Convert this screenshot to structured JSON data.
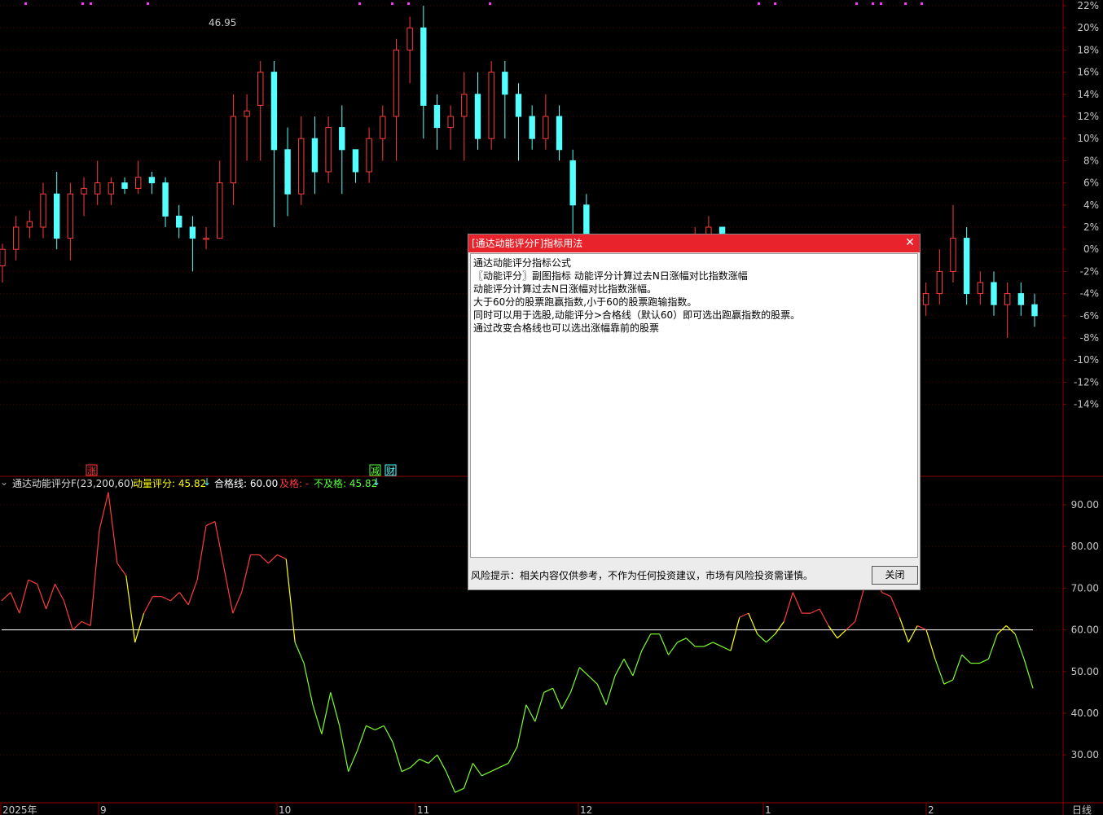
{
  "colors": {
    "up": "#ff3b3b",
    "down": "#54ffff",
    "ma_yellow": "#ffff00",
    "pass_line": "#ffffff",
    "grid": "#5a0000",
    "dialog_title": "#e8232b"
  },
  "price_axis": {
    "labels": [
      "22%",
      "20%",
      "18%",
      "16%",
      "14%",
      "12%",
      "10%",
      "8%",
      "6%",
      "4%",
      "2%",
      "0%",
      "-2%",
      "-4%",
      "-6%",
      "-8%",
      "-10%",
      "-12%",
      "-14%"
    ]
  },
  "indicator_axis": {
    "labels": [
      "90.00",
      "80.00",
      "70.00",
      "60.00",
      "50.00",
      "40.00",
      "30.00"
    ]
  },
  "time_axis": {
    "labels": [
      "2025年",
      "9",
      "10",
      "11",
      "12",
      "1",
      "2"
    ],
    "period": "日线"
  },
  "high_marker": "46.95",
  "event_badges": [
    "涨",
    "减",
    "财"
  ],
  "indicator": {
    "name": "通达动能评分F(23,200,60)",
    "score_label": "动量评分: 45.82",
    "pass_line_label": "合格线: 60.00",
    "pass_label": "及格: -",
    "fail_label": "不及格: 45.82"
  },
  "dialog": {
    "title": "[通达动能评分F]指标用法",
    "lines": [
      "通达动能评分指标公式",
      "",
      "〖动能评分〗副图指标 动能评分计算过去N日涨幅对比指数涨幅",
      "动能评分计算过去N日涨幅对比指数涨幅。",
      "大于60分的股票跑赢指数,小于60的股票跑输指数。",
      "",
      "同时可以用于选股,动能评分>合格线（默认60）即可选出跑赢指数的股票。",
      "通过改变合格线也可以选出涨幅靠前的股票"
    ],
    "risk_notice": "风险提示：相关内容仅供参考，不作为任何投资建议，市场有风险投资需谨慎。",
    "close_button": "关闭"
  },
  "chart_data": [
    {
      "type": "candlestick",
      "ylabel": "",
      "ylim": [
        -15,
        22
      ],
      "candles_pct": [
        [
          -1.5,
          0,
          -3,
          0.5
        ],
        [
          0,
          2,
          -1,
          3
        ],
        [
          2,
          2.5,
          1,
          3.5
        ],
        [
          2,
          5,
          1,
          6
        ],
        [
          5,
          1,
          0,
          7
        ],
        [
          1,
          5,
          -1,
          6
        ],
        [
          5,
          5.5,
          3,
          6.5
        ],
        [
          5,
          6,
          4,
          8
        ],
        [
          5,
          6,
          4,
          6.5
        ],
        [
          6,
          5.5,
          5,
          6.5
        ],
        [
          5.5,
          6.5,
          5,
          8
        ],
        [
          6.5,
          6,
          5,
          7
        ],
        [
          6,
          3,
          2,
          6.5
        ],
        [
          3,
          2,
          1,
          4
        ],
        [
          2,
          1,
          -2,
          3
        ],
        [
          1,
          1,
          0,
          2
        ],
        [
          1,
          6,
          1,
          8
        ],
        [
          6,
          12,
          4,
          14
        ],
        [
          12,
          12.5,
          8,
          14
        ],
        [
          13,
          16,
          8,
          17
        ],
        [
          16,
          9,
          2,
          17
        ],
        [
          9,
          5,
          3,
          11
        ],
        [
          5,
          10,
          4,
          12
        ],
        [
          10,
          7,
          5,
          12
        ],
        [
          7,
          11,
          6,
          12
        ],
        [
          11,
          9,
          5,
          13
        ],
        [
          9,
          7,
          6,
          9
        ],
        [
          7,
          10,
          6,
          11
        ],
        [
          10,
          12,
          8,
          13
        ],
        [
          12,
          18,
          8,
          19
        ],
        [
          18,
          20,
          15,
          21
        ],
        [
          20,
          13,
          10,
          22
        ],
        [
          13,
          11,
          9,
          14
        ],
        [
          11,
          12,
          9,
          13
        ],
        [
          12,
          14,
          8,
          16
        ],
        [
          14,
          10,
          9,
          16
        ],
        [
          10,
          16,
          9,
          17
        ],
        [
          16,
          14,
          10,
          17
        ],
        [
          14,
          12,
          8,
          15
        ],
        [
          12,
          10,
          9,
          13
        ],
        [
          10,
          12,
          9,
          14
        ],
        [
          12,
          9,
          8,
          13
        ],
        [
          8,
          4,
          0,
          9
        ],
        [
          4,
          -3,
          -5,
          5
        ],
        [
          -3,
          -1,
          -5,
          1
        ],
        [
          -1,
          -5,
          -6,
          0
        ],
        [
          -5,
          -7,
          -8,
          -4
        ],
        [
          -7,
          -5,
          -8,
          -4
        ],
        [
          -5,
          -3,
          -6,
          -2
        ],
        [
          -3,
          -4,
          -5,
          -2
        ],
        [
          -4,
          -1,
          -3,
          -2
        ],
        [
          -1,
          0,
          -3,
          2
        ],
        [
          0,
          2,
          -1,
          3
        ],
        [
          2,
          1,
          -1,
          2
        ],
        [
          1,
          -2,
          -3,
          0
        ],
        [
          -2,
          -3,
          -4,
          0
        ],
        [
          -3,
          -5,
          -6,
          -2
        ],
        [
          -5,
          -4,
          -5,
          -1
        ],
        [
          -4,
          -5,
          -6,
          -2
        ],
        [
          -5,
          -4,
          -6,
          -3
        ],
        [
          -4,
          -6,
          -7,
          -3
        ],
        [
          -6,
          -4,
          -7,
          -2
        ],
        [
          -4,
          -5,
          -6,
          -3
        ],
        [
          -5,
          -6,
          -7,
          -4
        ],
        [
          -6,
          -5,
          -7,
          -3
        ],
        [
          -5,
          -4,
          -6,
          -3
        ],
        [
          -4,
          -6,
          -7,
          -4
        ],
        [
          -6,
          -5,
          -8,
          -4
        ],
        [
          -5,
          -4,
          -6,
          -3
        ],
        [
          -4,
          -2,
          -5,
          0
        ],
        [
          -2,
          1,
          -3,
          4
        ],
        [
          1,
          -4,
          -5,
          2
        ],
        [
          -4,
          -3,
          -5,
          -2
        ],
        [
          -3,
          -5,
          -6,
          -2
        ],
        [
          -5,
          -4,
          -8,
          -3
        ],
        [
          -4,
          -5,
          -6,
          -3
        ],
        [
          -5,
          -6,
          -7,
          -4
        ]
      ]
    },
    {
      "type": "line",
      "title": "动量评分",
      "ylim": [
        25,
        95
      ],
      "pass_line": 60,
      "values": [
        67,
        69,
        64,
        72,
        71,
        65,
        71,
        67,
        60,
        62,
        61,
        84,
        93,
        76,
        73,
        57,
        64,
        68,
        68,
        67,
        69,
        66,
        72,
        85,
        86,
        75,
        64,
        69,
        78,
        78,
        76,
        78,
        77,
        57,
        52,
        42,
        35,
        45,
        37,
        26,
        31,
        37,
        36,
        37,
        33,
        26,
        27,
        29,
        28,
        30,
        26,
        21,
        22,
        28,
        25,
        26,
        27,
        28,
        32,
        42,
        38,
        45,
        46,
        41,
        45,
        51,
        49,
        47,
        42,
        49,
        53,
        49,
        55,
        59,
        59,
        54,
        57,
        58,
        56,
        56,
        57,
        56,
        55,
        63,
        64,
        59,
        57,
        59,
        62,
        69,
        64,
        64,
        65,
        61,
        58,
        60,
        62,
        70,
        74,
        69,
        68,
        63,
        57,
        61,
        60,
        53,
        47,
        48,
        54,
        52,
        52,
        53,
        59,
        61,
        59,
        53,
        46
      ]
    }
  ]
}
